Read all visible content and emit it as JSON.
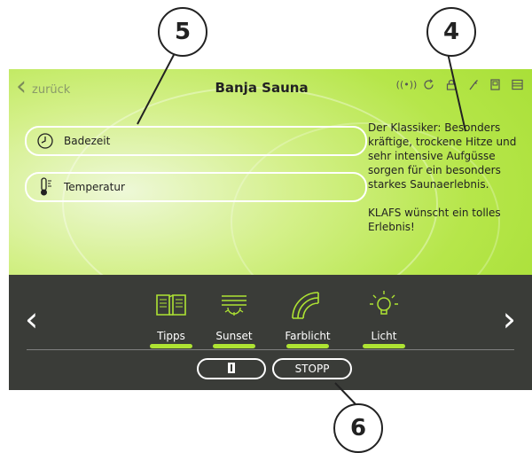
{
  "header": {
    "back_label": "zurück",
    "title": "Banja Sauna",
    "status_icons": [
      "signal-icon",
      "refresh-icon",
      "lock-icon",
      "tool-icon",
      "device-icon",
      "bed-icon"
    ]
  },
  "fields": [
    {
      "label": "Badezeit",
      "icon": "clock-icon"
    },
    {
      "label": "Temperatur",
      "icon": "thermometer-icon"
    }
  ],
  "description": {
    "text": "Der Klassiker: Besonders kräftige, trockene Hitze und sehr intensive Aufgüsse sorgen für ein besonders starkes Saunaerlebnis.",
    "closing": "KLAFS wünscht ein tolles Erlebnis!"
  },
  "toolbar": {
    "items": [
      {
        "label": "Tipps",
        "icon": "book-icon"
      },
      {
        "label": "Sunset",
        "icon": "sunset-icon"
      },
      {
        "label": "Farblicht",
        "icon": "rainbow-icon"
      },
      {
        "label": "Licht",
        "icon": "bulb-icon"
      }
    ],
    "stop_label": "STOPP",
    "door_icon": "door-icon",
    "nav_prev": "prev-arrow-icon",
    "nav_next": "next-arrow-icon"
  },
  "callouts": [
    "5",
    "4",
    "6"
  ],
  "colors": {
    "accent": "#aee333",
    "bar": "#3a3c38",
    "screen": "#b6e64a"
  }
}
